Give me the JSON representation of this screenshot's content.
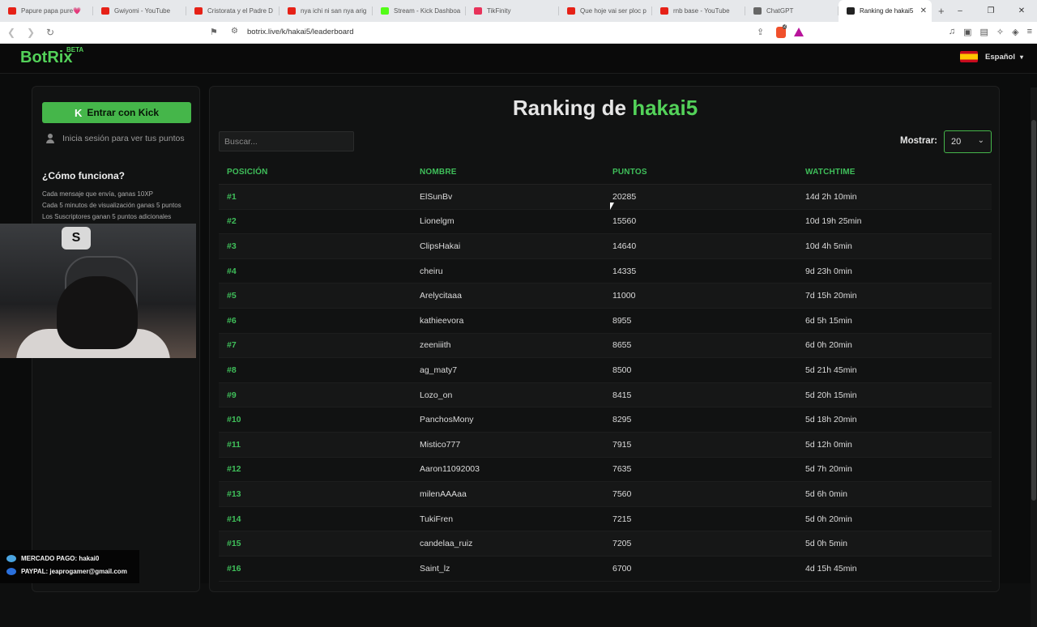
{
  "browser": {
    "tabs": [
      {
        "title": "Papure papa pure💗",
        "color": "#e62117"
      },
      {
        "title": "Gwiyomi - YouTube",
        "color": "#e62117"
      },
      {
        "title": "Cristorata y el Padre D",
        "color": "#e62117"
      },
      {
        "title": "nya ichi ni san nya arig",
        "color": "#e62117"
      },
      {
        "title": "Stream - Kick Dashboa",
        "color": "#53fc18"
      },
      {
        "title": "TikFinity",
        "color": "#e8325a"
      },
      {
        "title": "Que hoje vai ser ploc p",
        "color": "#e62117"
      },
      {
        "title": "rnb base - YouTube",
        "color": "#e62117"
      },
      {
        "title": "ChatGPT",
        "color": "#666666"
      },
      {
        "title": "Ranking de hakai5",
        "color": "#222222",
        "active": true
      }
    ],
    "url": "botrix.live/k/hakai5/leaderboard",
    "new_tab": "+",
    "controls": {
      "minimize": "–",
      "restore": "❐",
      "close": "✕"
    }
  },
  "site": {
    "logo": "BotRix",
    "beta": "BETA",
    "language": "Español",
    "login_button": "Entrar con Kick",
    "login_hint": "Inicia sesión para ver tus puntos",
    "how_title": "¿Cómo funciona?",
    "how_lines": [
      "Cada mensaje que envía, ganas 10XP",
      "Cada 5 minutos de visualización ganas 5 puntos",
      "Los Suscriptores ganan 5 puntos adicionales"
    ],
    "title_prefix": "Ranking de",
    "channel": "hakai5",
    "search_placeholder": "Buscar...",
    "show_label": "Mostrar:",
    "show_value": "20",
    "columns": [
      "POSICIÓN",
      "NOMBRE",
      "PUNTOS",
      "WATCHTIME"
    ],
    "rows": [
      {
        "pos": "#1",
        "name": "ElSunBv",
        "points": "20285",
        "watch": "14d 2h 10min"
      },
      {
        "pos": "#2",
        "name": "Lionelgm",
        "points": "15560",
        "watch": "10d 19h 25min"
      },
      {
        "pos": "#3",
        "name": "ClipsHakai",
        "points": "14640",
        "watch": "10d 4h 5min"
      },
      {
        "pos": "#4",
        "name": "cheiru",
        "points": "14335",
        "watch": "9d 23h 0min"
      },
      {
        "pos": "#5",
        "name": "Arelycitaaa",
        "points": "11000",
        "watch": "7d 15h 20min"
      },
      {
        "pos": "#6",
        "name": "kathieevora",
        "points": "8955",
        "watch": "6d 5h 15min"
      },
      {
        "pos": "#7",
        "name": "zeeniiith",
        "points": "8655",
        "watch": "6d 0h 20min"
      },
      {
        "pos": "#8",
        "name": "ag_maty7",
        "points": "8500",
        "watch": "5d 21h 45min"
      },
      {
        "pos": "#9",
        "name": "Lozo_on",
        "points": "8415",
        "watch": "5d 20h 15min"
      },
      {
        "pos": "#10",
        "name": "PanchosMony",
        "points": "8295",
        "watch": "5d 18h 20min"
      },
      {
        "pos": "#11",
        "name": "Mistico777",
        "points": "7915",
        "watch": "5d 12h 0min"
      },
      {
        "pos": "#12",
        "name": "Aaron11092003",
        "points": "7635",
        "watch": "5d 7h 20min"
      },
      {
        "pos": "#13",
        "name": "milenAAAaa",
        "points": "7560",
        "watch": "5d 6h 0min"
      },
      {
        "pos": "#14",
        "name": "TukiFren",
        "points": "7215",
        "watch": "5d 0h 20min"
      },
      {
        "pos": "#15",
        "name": "candelaa_ruiz",
        "points": "7205",
        "watch": "5d 0h 5min"
      },
      {
        "pos": "#16",
        "name": "Saint_lz",
        "points": "6700",
        "watch": "4d 15h 45min"
      }
    ]
  },
  "overlay": {
    "mercado": "MERCADO PAGO: hakai0",
    "paypal": "PAYPAL: jeaprogamer@gmail.com"
  }
}
